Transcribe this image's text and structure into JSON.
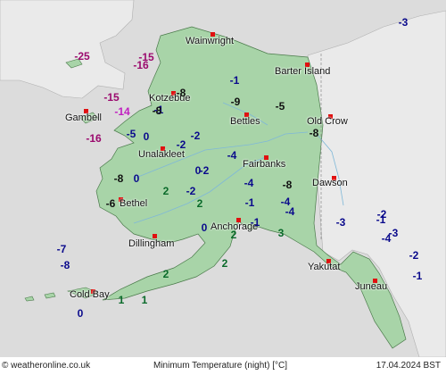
{
  "footer": {
    "source": "© weatheronline.co.uk",
    "title": "Minimum Temperature (night) [°C]",
    "date": "17.04.2024 BST"
  },
  "colors": {
    "land": "#a8d4a8",
    "neighbour_land": "#eaeaea",
    "sea": "#dcdcdc",
    "city_marker": "#e01010",
    "temp_very_cold": "#9b0a6e",
    "temp_cold_purple": "#c020c0",
    "temp_cold": "#0a0a8c",
    "temp_cool": "#111111",
    "temp_mild": "#0a6a2a"
  },
  "cities": [
    {
      "id": "wainwright",
      "name": "Wainwright"
    },
    {
      "id": "barter-island",
      "name": "Barter Island"
    },
    {
      "id": "kotzebue",
      "name": "Kotzebue"
    },
    {
      "id": "gambell",
      "name": "Gambell"
    },
    {
      "id": "bettles",
      "name": "Bettles"
    },
    {
      "id": "old-crow",
      "name": "Old Crow"
    },
    {
      "id": "unalakleet",
      "name": "Unalakleet"
    },
    {
      "id": "fairbanks",
      "name": "Fairbanks"
    },
    {
      "id": "dawson",
      "name": "Dawson"
    },
    {
      "id": "bethel",
      "name": "Bethel"
    },
    {
      "id": "anchorage",
      "name": "Anchorage"
    },
    {
      "id": "dillingham",
      "name": "Dillingham"
    },
    {
      "id": "yakutat",
      "name": "Yakutat"
    },
    {
      "id": "juneau",
      "name": "Juneau"
    },
    {
      "id": "cold-bay",
      "name": "Cold Bay"
    }
  ],
  "temperatures": [
    {
      "value": "-3",
      "tone": "temp_cold"
    },
    {
      "value": "-25",
      "tone": "temp_very_cold"
    },
    {
      "value": "-15",
      "tone": "temp_very_cold"
    },
    {
      "value": "-16",
      "tone": "temp_very_cold"
    },
    {
      "value": "-1",
      "tone": "temp_cold"
    },
    {
      "value": "-15",
      "tone": "temp_very_cold"
    },
    {
      "value": "-8",
      "tone": "temp_cool"
    },
    {
      "value": "-1",
      "tone": "temp_cold"
    },
    {
      "value": "-9",
      "tone": "temp_cool"
    },
    {
      "value": "-5",
      "tone": "temp_cool"
    },
    {
      "value": "-14",
      "tone": "temp_cold_purple"
    },
    {
      "value": "-8",
      "tone": "temp_cool"
    },
    {
      "value": "-16",
      "tone": "temp_very_cold"
    },
    {
      "value": "-5",
      "tone": "temp_cold"
    },
    {
      "value": "0",
      "tone": "temp_cold"
    },
    {
      "value": "-2",
      "tone": "temp_cold"
    },
    {
      "value": "-2",
      "tone": "temp_cold"
    },
    {
      "value": "-8",
      "tone": "temp_cool"
    },
    {
      "value": "-4",
      "tone": "temp_cold"
    },
    {
      "value": "0",
      "tone": "temp_cold"
    },
    {
      "value": "-2",
      "tone": "temp_cold"
    },
    {
      "value": "-8",
      "tone": "temp_cool"
    },
    {
      "value": "0",
      "tone": "temp_cold"
    },
    {
      "value": "2",
      "tone": "temp_mild"
    },
    {
      "value": "-2",
      "tone": "temp_cold"
    },
    {
      "value": "-4",
      "tone": "temp_cold"
    },
    {
      "value": "-8",
      "tone": "temp_cool"
    },
    {
      "value": "-6",
      "tone": "temp_cool"
    },
    {
      "value": "2",
      "tone": "temp_mild"
    },
    {
      "value": "-1",
      "tone": "temp_cold"
    },
    {
      "value": "-4",
      "tone": "temp_cold"
    },
    {
      "value": "-4",
      "tone": "temp_cold"
    },
    {
      "value": "0",
      "tone": "temp_cold"
    },
    {
      "value": "2",
      "tone": "temp_mild"
    },
    {
      "value": "-1",
      "tone": "temp_cold"
    },
    {
      "value": "-3",
      "tone": "temp_cold"
    },
    {
      "value": "-2",
      "tone": "temp_cold"
    },
    {
      "value": "-1",
      "tone": "temp_cold"
    },
    {
      "value": "-3",
      "tone": "temp_cold"
    },
    {
      "value": "-4",
      "tone": "temp_cold"
    },
    {
      "value": "3",
      "tone": "temp_mild"
    },
    {
      "value": "-7",
      "tone": "temp_cold"
    },
    {
      "value": "-8",
      "tone": "temp_cold"
    },
    {
      "value": "2",
      "tone": "temp_mild"
    },
    {
      "value": "2",
      "tone": "temp_mild"
    },
    {
      "value": "-2",
      "tone": "temp_cold"
    },
    {
      "value": "-1",
      "tone": "temp_cold"
    },
    {
      "value": "1",
      "tone": "temp_mild"
    },
    {
      "value": "1",
      "tone": "temp_mild"
    },
    {
      "value": "0",
      "tone": "temp_cold"
    }
  ]
}
